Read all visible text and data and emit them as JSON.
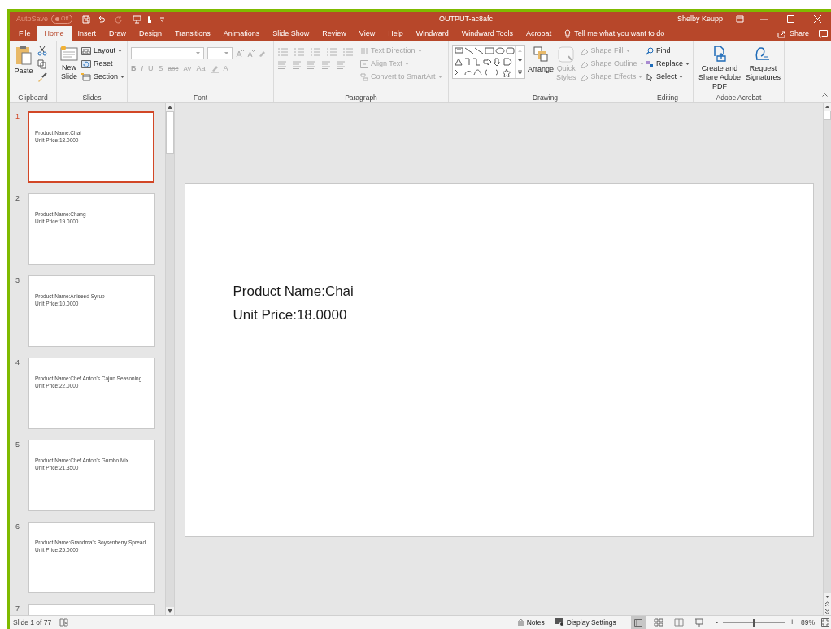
{
  "title_bar": {
    "autosave_label": "AutoSave",
    "autosave_state": "Off",
    "autosave_on": false,
    "title": "OUTPUT-ac8afc",
    "user": "Shelby Keupp"
  },
  "tabs": [
    {
      "label": "File",
      "selected": false
    },
    {
      "label": "Home",
      "selected": true
    },
    {
      "label": "Insert",
      "selected": false
    },
    {
      "label": "Draw",
      "selected": false
    },
    {
      "label": "Design",
      "selected": false
    },
    {
      "label": "Transitions",
      "selected": false
    },
    {
      "label": "Animations",
      "selected": false
    },
    {
      "label": "Slide Show",
      "selected": false
    },
    {
      "label": "Review",
      "selected": false
    },
    {
      "label": "View",
      "selected": false
    },
    {
      "label": "Help",
      "selected": false
    },
    {
      "label": "Windward",
      "selected": false
    },
    {
      "label": "Windward Tools",
      "selected": false
    },
    {
      "label": "Acrobat",
      "selected": false
    }
  ],
  "tell_me": "Tell me what you want to do",
  "share": "Share",
  "ribbon": {
    "clipboard": {
      "paste": "Paste",
      "group": "Clipboard"
    },
    "slides": {
      "new_slide": "New Slide",
      "layout": "Layout",
      "reset": "Reset",
      "section": "Section",
      "group": "Slides"
    },
    "font": {
      "disabled": true,
      "bold": "B",
      "italic": "I",
      "underline": "U",
      "shadow": "S",
      "strike": "abc",
      "spacing": "AV",
      "case": "Aa",
      "text_color": "A",
      "group": "Font"
    },
    "paragraph": {
      "disabled": true,
      "text_direction": "Text Direction",
      "align_text": "Align Text",
      "smartart": "Convert to SmartArt",
      "group": "Paragraph"
    },
    "drawing": {
      "arrange": "Arrange",
      "quick_styles": {
        "label": "Quick Styles",
        "disabled": true
      },
      "items": [
        {
          "label": "Shape Fill",
          "disabled": true
        },
        {
          "label": "Shape Outline",
          "disabled": true
        },
        {
          "label": "Shape Effects",
          "disabled": true
        }
      ],
      "group": "Drawing"
    },
    "editing": {
      "find": "Find",
      "replace": "Replace",
      "select": "Select",
      "group": "Editing"
    },
    "acrobat": {
      "create": "Create and Share Adobe PDF",
      "request": "Request Signatures",
      "group": "Adobe Acrobat"
    }
  },
  "slides": [
    {
      "number": "1",
      "selected": true,
      "lines": [
        "Product Name:Chai",
        "Unit Price:18.0000"
      ]
    },
    {
      "number": "2",
      "selected": false,
      "lines": [
        "Product Name:Chang",
        "Unit Price:19.0000"
      ]
    },
    {
      "number": "3",
      "selected": false,
      "lines": [
        "Product Name:Aniseed Syrup",
        "Unit Price:10.0000"
      ]
    },
    {
      "number": "4",
      "selected": false,
      "lines": [
        "Product Name:Chef Anton's Cajun Seasoning",
        "Unit Price:22.0000"
      ]
    },
    {
      "number": "5",
      "selected": false,
      "lines": [
        "Product Name:Chef Anton's Gumbo Mix",
        "Unit Price:21.3500"
      ]
    },
    {
      "number": "6",
      "selected": false,
      "lines": [
        "Product Name:Grandma's Boysenberry Spread",
        "Unit Price:25.0000"
      ]
    },
    {
      "number": "7",
      "selected": false
    }
  ],
  "current_slide": {
    "lines": [
      "Product Name:Chai",
      "Unit Price:18.0000"
    ]
  },
  "status_bar": {
    "slide_count": "Slide 1 of 77",
    "notes": "Notes",
    "display_settings": "Display Settings",
    "views": [
      {
        "selected": true
      },
      {
        "selected": false
      },
      {
        "selected": false
      },
      {
        "selected": false
      }
    ],
    "zoom_out": "-",
    "zoom": {
      "level": 0.5
    },
    "zoom_in": "+",
    "zoom_percent": "89%"
  }
}
